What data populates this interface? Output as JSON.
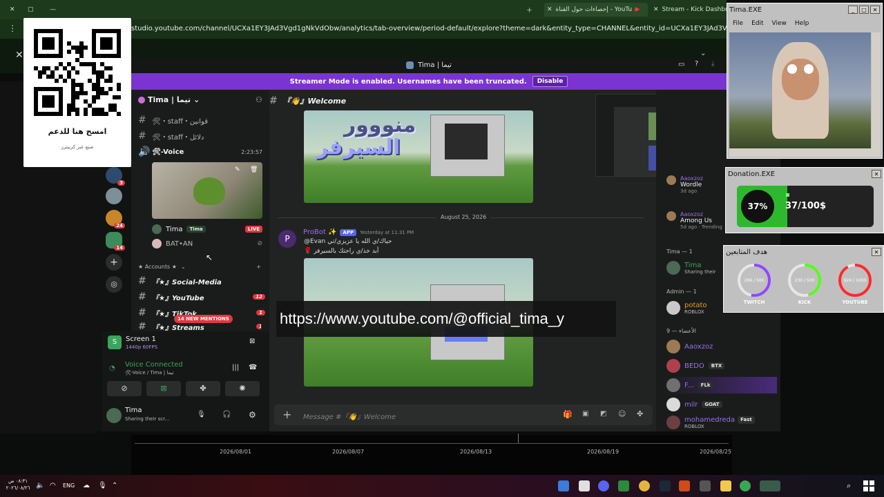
{
  "browser": {
    "tabs": [
      {
        "label": "إحصاءات حول القناة - YouTube Studio"
      },
      {
        "label": "Stream - Kick Dashboard"
      }
    ],
    "url": "studio.youtube.com/channel/UCXa1EY3JAd3Vgd1gNkVdObw/analytics/tab-overview/period-default/explore?theme=dark&entity_type=CHANNEL&entity_id=UCXa1EY3JAd3Vgd1gNkVdObw&time_period=4_weeks"
  },
  "qr_card": {
    "heading": "امسح هنا للدعم",
    "subtext": "صنع عبر كرييترز"
  },
  "discord": {
    "window_title": "Tima | تيما",
    "banner": {
      "text": "Streamer Mode is enabled. Usernames have been truncated.",
      "button": "Disable"
    },
    "server_name": "Tima | تيما",
    "server_badges": [
      "3",
      "24",
      "14"
    ],
    "channels_top": [
      {
        "label": "🛠・staff・قوانين"
      },
      {
        "label": "🛠・staff・دلائل"
      }
    ],
    "voice_channel": {
      "label": "🛠-Voice",
      "timer": "2:23:57"
    },
    "voice_users": [
      {
        "name": "Tima",
        "tag": "Tima",
        "live": "LIVE"
      },
      {
        "name": "BAT•AN"
      }
    ],
    "category": "★ Accounts ★",
    "channels": [
      {
        "label": "『★』Social-Media",
        "badge": ""
      },
      {
        "label": "『★』YouTube",
        "badge": "12"
      },
      {
        "label": "『★』TikTok",
        "badge": "1"
      },
      {
        "label": "『★』Streams",
        "badge": "1"
      }
    ],
    "new_mentions": "14 NEW MENTIONS",
    "screen_share": {
      "title": "Screen 1",
      "sub": "1440p 60FPS"
    },
    "voice_connected": {
      "title": "Voice Connected",
      "sub": "🛠-Voice / Tima | تيما"
    },
    "user": {
      "name": "Tima",
      "status": "Sharing their scr..."
    },
    "chat": {
      "channel": "『👋』Welcome",
      "image_text_1": "منووور",
      "image_text_2": "السيرفر",
      "date_divider": "August 25, 2026",
      "message": {
        "author": "ProBot ✨",
        "app_tag": "APP",
        "time": "Yesterday at 11:31 PM",
        "line1": "@Evan حياك/ي الله يا عزيزي/تي",
        "line2": "🌹 أبد خذ/ي راحتك بالسيرفر"
      },
      "input_placeholder": "Message #『👋』Welcome"
    },
    "members": {
      "activities": [
        {
          "name": "Aaoxzoz",
          "game": "Wordle",
          "ago": "3d ago"
        },
        {
          "name": "Aaoxzoz",
          "game": "Among Us",
          "ago": "5d ago",
          "extra": "Trending"
        }
      ],
      "group_tima": "Tima — 1",
      "tima": {
        "name": "Tima",
        "status": "Sharing their"
      },
      "group_admin": "Admin — 1",
      "admin": {
        "name": "potato",
        "status": "ROBLOX"
      },
      "group_members": "الأعضاء — 9",
      "list": [
        {
          "name": "Aaoxzoz",
          "tag": ""
        },
        {
          "name": "BEDO",
          "tag": "BTX"
        },
        {
          "name": "F...",
          "tag": "FLk"
        },
        {
          "name": "milr",
          "tag": "GOAT"
        },
        {
          "name": "mohamedreda",
          "tag": "Fast",
          "status": "ROBLOX"
        }
      ]
    }
  },
  "tima_window": {
    "title": "Tima.EXE",
    "menu": [
      "File",
      "Edit",
      "View",
      "Help"
    ]
  },
  "donation_window": {
    "title": "Donation.EXE",
    "percent": "37%",
    "amount": "37/100$",
    "progress_fraction": 0.37
  },
  "goals_window": {
    "title": "هدف المتابعين",
    "goals": [
      {
        "label": "TWITCH",
        "value": "266 / 500",
        "color": "#9146ff",
        "fraction": 0.53
      },
      {
        "label": "KICK",
        "value": "230 / 500",
        "color": "#53fc18",
        "fraction": 0.46
      },
      {
        "label": "YOUTUBE",
        "value": "924 / 1000",
        "color": "#ff2a2a",
        "fraction": 0.92
      }
    ]
  },
  "url_overlay": "https://www.youtube.com/@official_tima_y",
  "timeline": {
    "dates": [
      "2026/08/01",
      "2026/08/07",
      "2026/08/13",
      "2026/08/19",
      "2026/08/25"
    ]
  },
  "taskbar": {
    "lang": "ENG",
    "time": "٠٨:٣١ ص",
    "date": "٢٠٢٦/٠٨/٢٦"
  }
}
